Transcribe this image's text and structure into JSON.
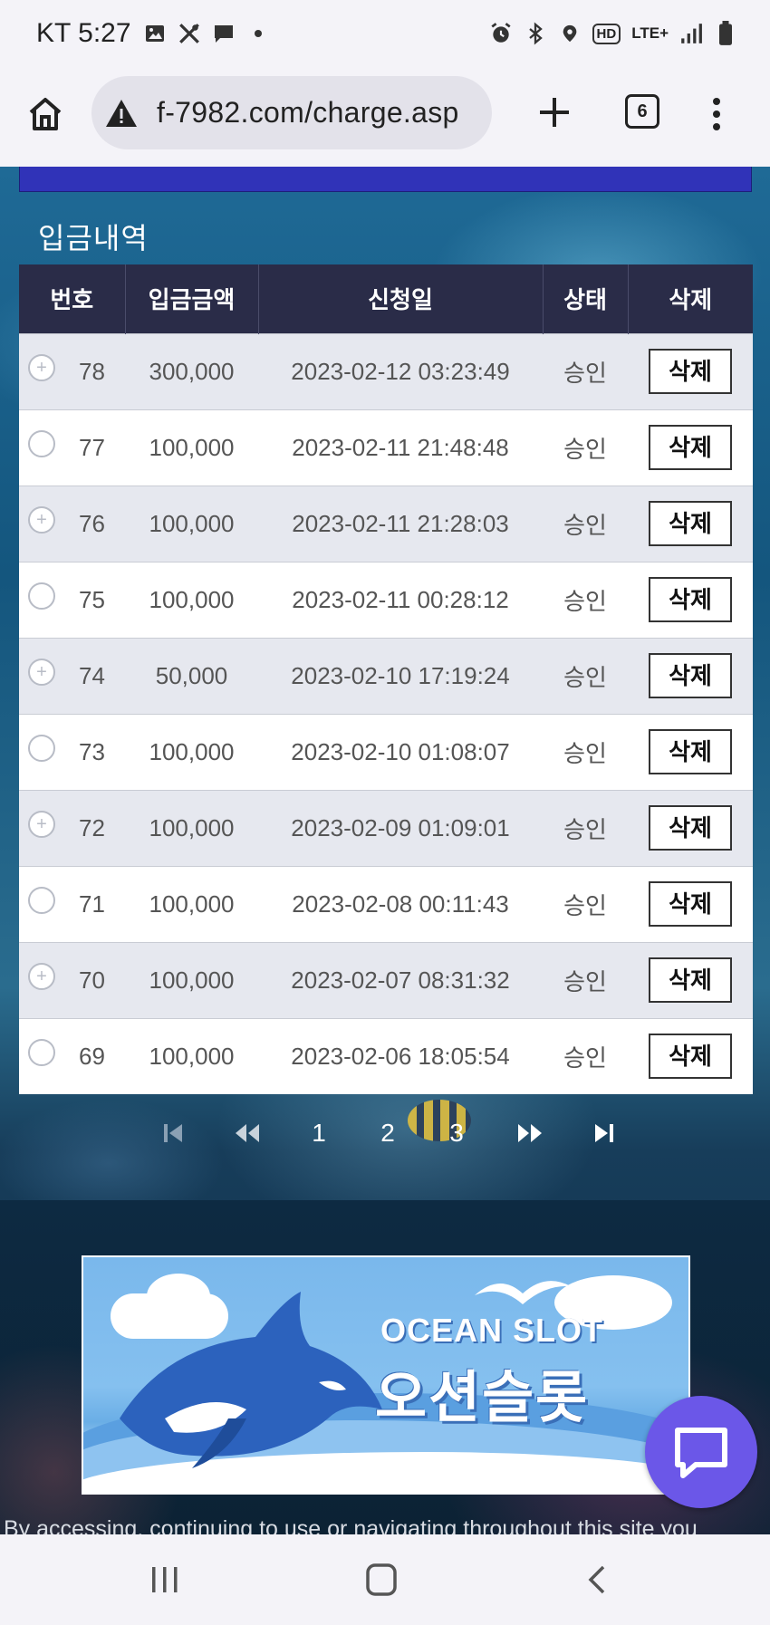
{
  "status_bar": {
    "time": "KT 5:27",
    "left_icons": [
      "image-icon",
      "tools-icon",
      "chat-icon",
      "dot-icon"
    ],
    "right_icons": [
      "alarm-icon",
      "bluetooth-icon",
      "location-icon",
      "hd-icon",
      "lte-icon",
      "signal-icon",
      "battery-icon"
    ],
    "hd_label": "HD",
    "lte_label": "LTE+"
  },
  "browser": {
    "url": "f-7982.com/charge.asp",
    "tab_count": "6"
  },
  "page": {
    "section_title": "입금내역",
    "table": {
      "headers": [
        "번호",
        "입금금액",
        "신청일",
        "상태",
        "삭제"
      ],
      "rows": [
        {
          "no": "78",
          "amount": "300,000",
          "date": "2023-02-12 03:23:49",
          "status": "승인",
          "action": "삭제"
        },
        {
          "no": "77",
          "amount": "100,000",
          "date": "2023-02-11 21:48:48",
          "status": "승인",
          "action": "삭제"
        },
        {
          "no": "76",
          "amount": "100,000",
          "date": "2023-02-11 21:28:03",
          "status": "승인",
          "action": "삭제"
        },
        {
          "no": "75",
          "amount": "100,000",
          "date": "2023-02-11 00:28:12",
          "status": "승인",
          "action": "삭제"
        },
        {
          "no": "74",
          "amount": "50,000",
          "date": "2023-02-10 17:19:24",
          "status": "승인",
          "action": "삭제"
        },
        {
          "no": "73",
          "amount": "100,000",
          "date": "2023-02-10 01:08:07",
          "status": "승인",
          "action": "삭제"
        },
        {
          "no": "72",
          "amount": "100,000",
          "date": "2023-02-09 01:09:01",
          "status": "승인",
          "action": "삭제"
        },
        {
          "no": "71",
          "amount": "100,000",
          "date": "2023-02-08 00:11:43",
          "status": "승인",
          "action": "삭제"
        },
        {
          "no": "70",
          "amount": "100,000",
          "date": "2023-02-07 08:31:32",
          "status": "승인",
          "action": "삭제"
        },
        {
          "no": "69",
          "amount": "100,000",
          "date": "2023-02-06 18:05:54",
          "status": "승인",
          "action": "삭제"
        }
      ]
    },
    "pagination": {
      "pages": [
        "1",
        "2",
        "3"
      ],
      "first_icon": "first-page-icon",
      "prev_icon": "prev-page-icon",
      "next_icon": "next-page-icon",
      "last_icon": "last-page-icon"
    },
    "banner": {
      "title_en": "OCEAN SLOT",
      "title_ko": "오션슬롯"
    },
    "cookie_notice": "By accessing, continuing to use or navigating throughout this site you"
  },
  "colors": {
    "table_header": "#2a2c48",
    "blue_strip": "#3033b8",
    "chat_button": "#6b57e8"
  }
}
